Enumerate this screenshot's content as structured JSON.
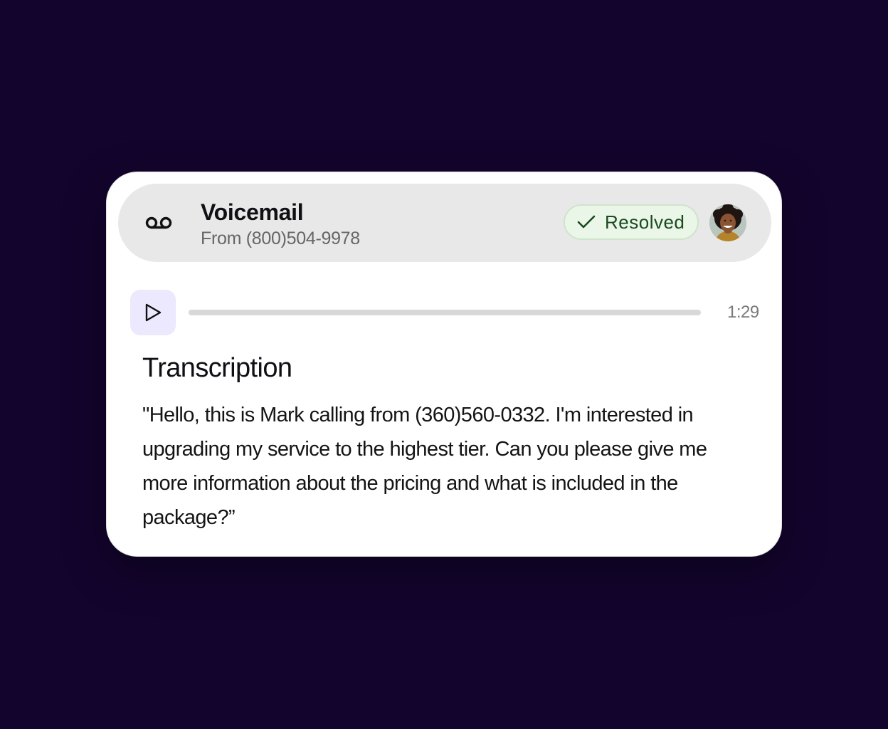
{
  "voicemail": {
    "title": "Voicemail",
    "from": "From (800)504-9978",
    "icon": "voicemail-icon",
    "status": {
      "label": "Resolved",
      "icon": "check-icon",
      "color": "#1a4a1f",
      "background": "#eaf6e8"
    },
    "avatar_icon": "avatar"
  },
  "player": {
    "play_icon": "play-icon",
    "duration": "1:29",
    "progress": 0,
    "accent": "#ece8fd"
  },
  "transcription": {
    "title": "Transcription",
    "text": "\"Hello, this is Mark calling from (360)560-0332. I'm interested in upgrading my service to the highest tier. Can you please give me more information about the pricing and what is included in the package?”"
  },
  "colors": {
    "page_background": "#13042d",
    "card_background": "#ffffff",
    "header_background": "#e8e8e8"
  }
}
